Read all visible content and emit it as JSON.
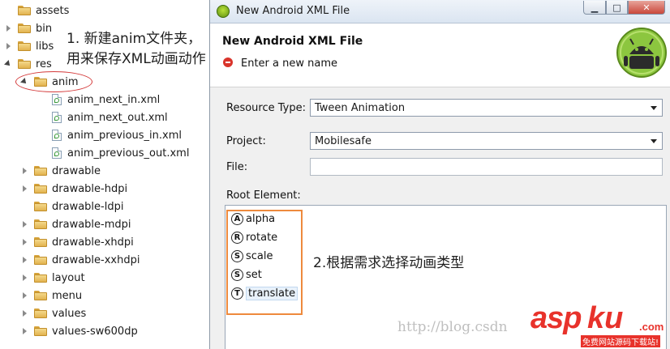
{
  "tree": {
    "items": [
      {
        "label": "assets"
      },
      {
        "label": "bin"
      },
      {
        "label": "libs"
      },
      {
        "label": "res"
      },
      {
        "label": "anim"
      },
      {
        "label": "anim_next_in.xml"
      },
      {
        "label": "anim_next_out.xml"
      },
      {
        "label": "anim_previous_in.xml"
      },
      {
        "label": "anim_previous_out.xml"
      },
      {
        "label": "drawable"
      },
      {
        "label": "drawable-hdpi"
      },
      {
        "label": "drawable-ldpi"
      },
      {
        "label": "drawable-mdpi"
      },
      {
        "label": "drawable-xhdpi"
      },
      {
        "label": "drawable-xxhdpi"
      },
      {
        "label": "layout"
      },
      {
        "label": "menu"
      },
      {
        "label": "values"
      },
      {
        "label": "values-sw600dp"
      }
    ]
  },
  "annotations": {
    "note1_line1": "1. 新建anim文件夹，",
    "note1_line2": "用来保存XML动画动作",
    "note2": "2.根据需求选择动画类型"
  },
  "dialog": {
    "window_title": "New Android XML File",
    "banner_title": "New Android XML File",
    "banner_message": "Enter a new name",
    "resource_type_label": "Resource Type:",
    "resource_type_value": "Tween Animation",
    "project_label": "Project:",
    "project_value": "Mobilesafe",
    "file_label": "File:",
    "file_value": "",
    "root_element_label": "Root Element:",
    "root_elements": [
      {
        "badge": "A",
        "label": "alpha"
      },
      {
        "badge": "R",
        "label": "rotate"
      },
      {
        "badge": "S",
        "label": "scale"
      },
      {
        "badge": "S",
        "label": "set"
      },
      {
        "badge": "T",
        "label": "translate"
      }
    ],
    "selected_root_element": "translate",
    "window_buttons": {
      "minimize": "▁",
      "maximize": "□",
      "close": "✕"
    }
  },
  "watermark": "http://blog.csdn",
  "logo": {
    "asp": "asp",
    "ku": "ku",
    "com": ".com",
    "slogan": "免费网站源码下载站!"
  },
  "colors": {
    "annotation_ellipse": "#d43a3a",
    "root_highlight": "#ee8a3d",
    "logo_red": "#e8322b",
    "title_bar": "#dbe5f1"
  },
  "icons": {
    "folder": "folder-icon",
    "xml_file": "xml-file-icon",
    "android": "android-logo-icon",
    "error": "error-icon"
  }
}
